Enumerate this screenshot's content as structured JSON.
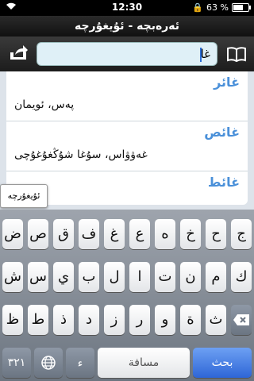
{
  "status": {
    "carrier": "",
    "time": "12:30",
    "battery": "63 %",
    "lock_icon": "lock-icon"
  },
  "title": "ئەرەبچە - ئۇيغۇرچە",
  "search": {
    "value": "غا",
    "placeholder": ""
  },
  "results": [
    {
      "head": "غائر",
      "def": "پەس، ئويمان"
    },
    {
      "head": "غائص",
      "def": "غەۋۋاس، سۇغا شۇڭغۇغۇچى"
    },
    {
      "head": "غائط",
      "def": ""
    }
  ],
  "popup": "ئۇيغۇرچە",
  "keyboard": {
    "row1": [
      "ض",
      "ص",
      "ق",
      "ف",
      "غ",
      "ع",
      "ه",
      "خ",
      "ح",
      "ج"
    ],
    "row2": [
      "ش",
      "س",
      "ي",
      "ب",
      "ل",
      "ا",
      "ت",
      "ن",
      "م",
      "ك"
    ],
    "row3": [
      "ظ",
      "ط",
      "ذ",
      "د",
      "ز",
      "ر",
      "و",
      "ة",
      "ث"
    ],
    "numbers": "٣٢١",
    "space": "مسافة",
    "search": "بحث"
  }
}
